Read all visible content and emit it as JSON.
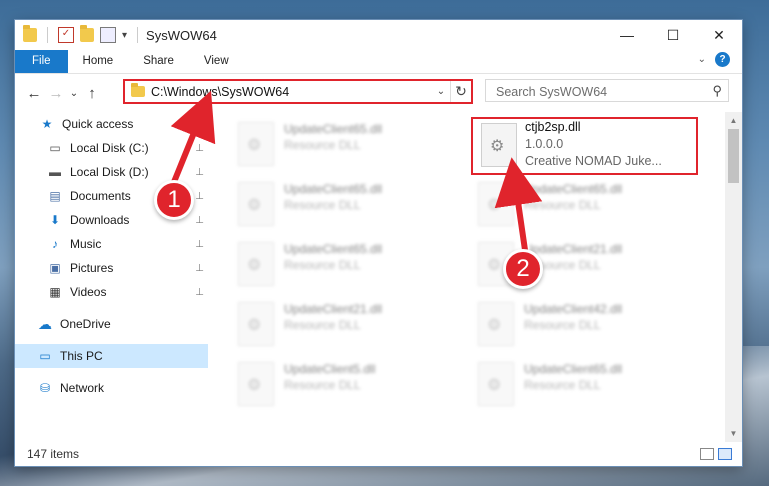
{
  "window": {
    "title": "SysWOW64",
    "qa_dropdown": "▾",
    "minimize": "—",
    "maximize": "☐",
    "close": "✕"
  },
  "ribbon": {
    "tabs": [
      "File",
      "Home",
      "Share",
      "View"
    ],
    "expand_icon": "chevron-down-icon",
    "help": "?"
  },
  "nav": {
    "back": "←",
    "forward": "→",
    "recent": "⌄",
    "up": "↑"
  },
  "address": {
    "path": "C:\\Windows\\SysWOW64",
    "dropdown": "⌄",
    "refresh": "↻"
  },
  "search": {
    "placeholder": "Search SysWOW64",
    "icon": "⚲"
  },
  "sidebar": {
    "items": [
      {
        "label": "Quick access",
        "icon": "★",
        "pinned": false
      },
      {
        "label": "Local Disk (C:)",
        "icon": "▭",
        "pinned": true
      },
      {
        "label": "Local Disk (D:)",
        "icon": "▬",
        "pinned": true
      },
      {
        "label": "Documents",
        "icon": "▤",
        "pinned": true
      },
      {
        "label": "Downloads",
        "icon": "⬇",
        "pinned": true
      },
      {
        "label": "Music",
        "icon": "♪",
        "pinned": true
      },
      {
        "label": "Pictures",
        "icon": "▣",
        "pinned": true
      },
      {
        "label": "Videos",
        "icon": "▦",
        "pinned": true
      },
      {
        "label": "OneDrive",
        "icon": "☁",
        "pinned": false
      },
      {
        "label": "This PC",
        "icon": "▭",
        "pinned": false
      },
      {
        "label": "Network",
        "icon": "⛁",
        "pinned": false
      }
    ],
    "pin_glyph": "📌"
  },
  "files": {
    "left_column": [
      {
        "name": "UpdateClient65.dll",
        "desc": "Resource DLL"
      },
      {
        "name": "UpdateClient65.dll",
        "desc": "Resource DLL"
      },
      {
        "name": "UpdateClient65.dll",
        "desc": "Resource DLL"
      },
      {
        "name": "UpdateClient21.dll",
        "desc": "Resource DLL"
      },
      {
        "name": "UpdateClient5.dll",
        "desc": "Resource DLL"
      }
    ],
    "right_column": [
      {
        "name": "UpdateClient65.dll",
        "desc": "Resource DLL"
      },
      {
        "name": "UpdateClient21.dll",
        "desc": "Resource DLL"
      },
      {
        "name": "UpdateClient42.dll",
        "desc": "Resource DLL"
      },
      {
        "name": "UpdateClient65.dll",
        "desc": "Resource DLL"
      }
    ],
    "highlighted": {
      "name": "ctjb2sp.dll",
      "version": "1.0.0.0",
      "company": "Creative NOMAD Juke..."
    }
  },
  "status": {
    "count": "147 items"
  },
  "callouts": {
    "one": "1",
    "two": "2"
  },
  "colors": {
    "accent": "#1979ca",
    "annotation_red": "#e0242c",
    "selected": "#cce8ff"
  }
}
